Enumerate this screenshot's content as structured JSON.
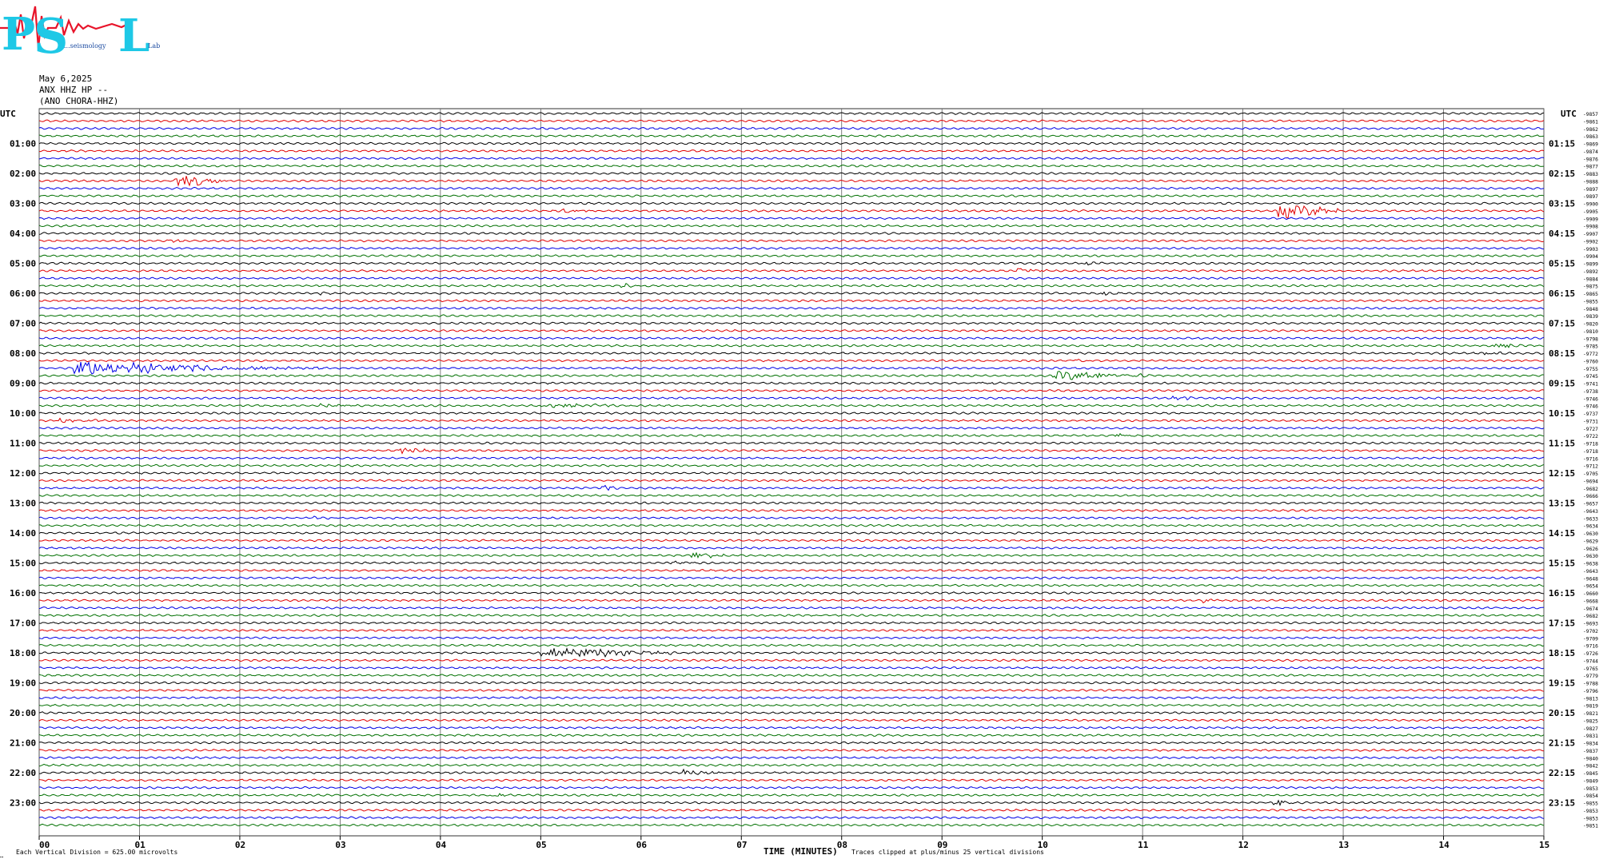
{
  "logo": {
    "text": "PSL",
    "sub_left": "...seismology",
    "sub_right": "Lab",
    "colors": [
      "#1ec8e6",
      "#e8142a"
    ]
  },
  "header": {
    "date": "May 6,2025",
    "station": "ANX HHZ HP --",
    "name": "(ANO CHORA-HHZ)"
  },
  "axes": {
    "left_corner": "UTC",
    "right_corner": "UTC",
    "left_hours": [
      "01:00",
      "02:00",
      "03:00",
      "04:00",
      "05:00",
      "06:00",
      "07:00",
      "08:00",
      "09:00",
      "10:00",
      "11:00",
      "12:00",
      "13:00",
      "14:00",
      "15:00",
      "16:00",
      "17:00",
      "18:00",
      "19:00",
      "20:00",
      "21:00",
      "22:00",
      "23:00"
    ],
    "right_hours": [
      "01:15",
      "02:15",
      "03:15",
      "04:15",
      "05:15",
      "06:15",
      "07:15",
      "08:15",
      "09:15",
      "10:15",
      "11:15",
      "12:15",
      "13:15",
      "14:15",
      "15:15",
      "16:15",
      "17:15",
      "18:15",
      "19:15",
      "20:15",
      "21:15",
      "22:15",
      "23:15"
    ],
    "x_ticks": [
      "00",
      "01",
      "02",
      "03",
      "04",
      "05",
      "06",
      "07",
      "08",
      "09",
      "10",
      "11",
      "12",
      "13",
      "14",
      "15"
    ],
    "xlabel": "TIME (MINUTES)"
  },
  "footer": {
    "left_mark": "…",
    "scale_note": "Each Vertical Division =  625.00 microvolts",
    "clip_note": "Traces clipped at plus/minus 25 vertical divisions"
  },
  "chart_data": {
    "type": "line",
    "title": "",
    "xlabel": "TIME (MINUTES)",
    "xlim": [
      0,
      15
    ],
    "trace_count": 96,
    "trace_duration_minutes": 15,
    "trace_colors": [
      "#000000",
      "#e00000",
      "#0000e6",
      "#007000"
    ],
    "grid": true,
    "right_values": [
      "-9857",
      "-9861",
      "-9862",
      "-9863",
      "-9869",
      "-9874",
      "-9876",
      "-9877",
      "-9883",
      "-9888",
      "-9897",
      "-9897",
      "-9900",
      "-9905",
      "-9909",
      "-9908",
      "-9907",
      "-9902",
      "-9903",
      "-9904",
      "-9899",
      "-9892",
      "-9884",
      "-9875",
      "-9865",
      "-9855",
      "-9848",
      "-9839",
      "-9820",
      "-9810",
      "-9798",
      "-9785",
      "-9772",
      "-9760",
      "-9755",
      "-9745",
      "-9741",
      "-9738",
      "-9746",
      "-9746",
      "-9737",
      "-9731",
      "-9727",
      "-9722",
      "-9718",
      "-9718",
      "-9716",
      "-9712",
      "-9705",
      "-9694",
      "-9682",
      "-9666",
      "-9657",
      "-9643",
      "-9633",
      "-9634",
      "-9630",
      "-9629",
      "-9626",
      "-9630",
      "-9638",
      "-9643",
      "-9648",
      "-9654",
      "-9660",
      "-9668",
      "-9674",
      "-9682",
      "-9693",
      "-9702",
      "-9709",
      "-9716",
      "-9726",
      "-9744",
      "-9765",
      "-9779",
      "-9788",
      "-9796",
      "-9813",
      "-9819",
      "-9821",
      "-9825",
      "-9827",
      "-9831",
      "-9834",
      "-9837",
      "-9840",
      "-9842",
      "-9845",
      "-9849",
      "-9853",
      "-9854",
      "-9855",
      "-9853",
      "-9853",
      "-9851"
    ],
    "events": [
      {
        "trace": 9,
        "start_min": 1.35,
        "duration_min": 0.5,
        "amp": 7
      },
      {
        "trace": 13,
        "start_min": 12.35,
        "duration_min": 0.6,
        "amp": 9
      },
      {
        "trace": 13,
        "start_min": 5.2,
        "duration_min": 0.3,
        "amp": 2
      },
      {
        "trace": 17,
        "start_min": 1.3,
        "duration_min": 0.2,
        "amp": 2
      },
      {
        "trace": 20,
        "start_min": 10.4,
        "duration_min": 0.2,
        "amp": 2
      },
      {
        "trace": 21,
        "start_min": 9.75,
        "duration_min": 0.3,
        "amp": 3
      },
      {
        "trace": 23,
        "start_min": 5.8,
        "duration_min": 0.3,
        "amp": 2
      },
      {
        "trace": 24,
        "start_min": 2.8,
        "duration_min": 0.15,
        "amp": 2
      },
      {
        "trace": 24,
        "start_min": 10.6,
        "duration_min": 0.2,
        "amp": 2
      },
      {
        "trace": 31,
        "start_min": 14.5,
        "duration_min": 0.3,
        "amp": 2
      },
      {
        "trace": 32,
        "start_min": 14.4,
        "duration_min": 0.2,
        "amp": 3
      },
      {
        "trace": 33,
        "start_min": 5.9,
        "duration_min": 0.2,
        "amp": 2
      },
      {
        "trace": 33,
        "start_min": 10.3,
        "duration_min": 0.2,
        "amp": 3
      },
      {
        "trace": 34,
        "start_min": 0.35,
        "duration_min": 1.6,
        "amp": 8
      },
      {
        "trace": 34,
        "start_min": 1.95,
        "duration_min": 1.0,
        "amp": 2
      },
      {
        "trace": 35,
        "start_min": 10.1,
        "duration_min": 1.0,
        "amp": 5
      },
      {
        "trace": 36,
        "start_min": 9.3,
        "duration_min": 0.3,
        "amp": 2
      },
      {
        "trace": 38,
        "start_min": 11.3,
        "duration_min": 0.3,
        "amp": 2
      },
      {
        "trace": 39,
        "start_min": 2.8,
        "duration_min": 0.4,
        "amp": 2
      },
      {
        "trace": 39,
        "start_min": 5.0,
        "duration_min": 1.0,
        "amp": 2
      },
      {
        "trace": 41,
        "start_min": 0.15,
        "duration_min": 0.5,
        "amp": 2
      },
      {
        "trace": 43,
        "start_min": 10.7,
        "duration_min": 0.2,
        "amp": 3
      },
      {
        "trace": 45,
        "start_min": 3.6,
        "duration_min": 0.4,
        "amp": 3
      },
      {
        "trace": 50,
        "start_min": 5.6,
        "duration_min": 0.2,
        "amp": 3
      },
      {
        "trace": 53,
        "start_min": 9.0,
        "duration_min": 0.2,
        "amp": 2
      },
      {
        "trace": 54,
        "start_min": 2.7,
        "duration_min": 0.3,
        "amp": 2
      },
      {
        "trace": 59,
        "start_min": 6.5,
        "duration_min": 0.4,
        "amp": 3
      },
      {
        "trace": 60,
        "start_min": 6.3,
        "duration_min": 0.3,
        "amp": 2
      },
      {
        "trace": 65,
        "start_min": 11.6,
        "duration_min": 0.2,
        "amp": 3
      },
      {
        "trace": 72,
        "start_min": 5.0,
        "duration_min": 1.35,
        "amp": 6
      },
      {
        "trace": 88,
        "start_min": 6.4,
        "duration_min": 0.4,
        "amp": 3
      },
      {
        "trace": 91,
        "start_min": 4.5,
        "duration_min": 0.3,
        "amp": 2
      },
      {
        "trace": 92,
        "start_min": 12.3,
        "duration_min": 0.2,
        "amp": 5
      }
    ]
  }
}
